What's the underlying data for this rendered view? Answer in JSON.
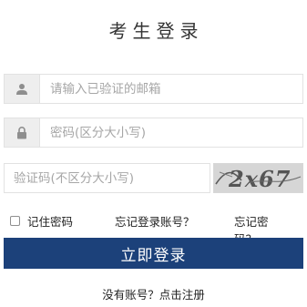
{
  "title": "考生登录",
  "email": {
    "placeholder": "请输入已验证的邮箱",
    "icon": "user-icon"
  },
  "password": {
    "placeholder": "密码(区分大小写)",
    "icon": "lock-icon"
  },
  "captcha": {
    "placeholder": "验证码(不区分大小写)",
    "image_text": "2x67"
  },
  "options": {
    "remember_label": "记住密码",
    "forgot_account": "忘记登录账号？",
    "forgot_password": "忘记密码？"
  },
  "login_button": "立即登录",
  "register": {
    "prompt": "没有账号？",
    "link": "点击注册"
  },
  "colors": {
    "primary_button": "#1c417a",
    "icon_bg": "#eeeeee",
    "border": "#e2e2e2"
  }
}
